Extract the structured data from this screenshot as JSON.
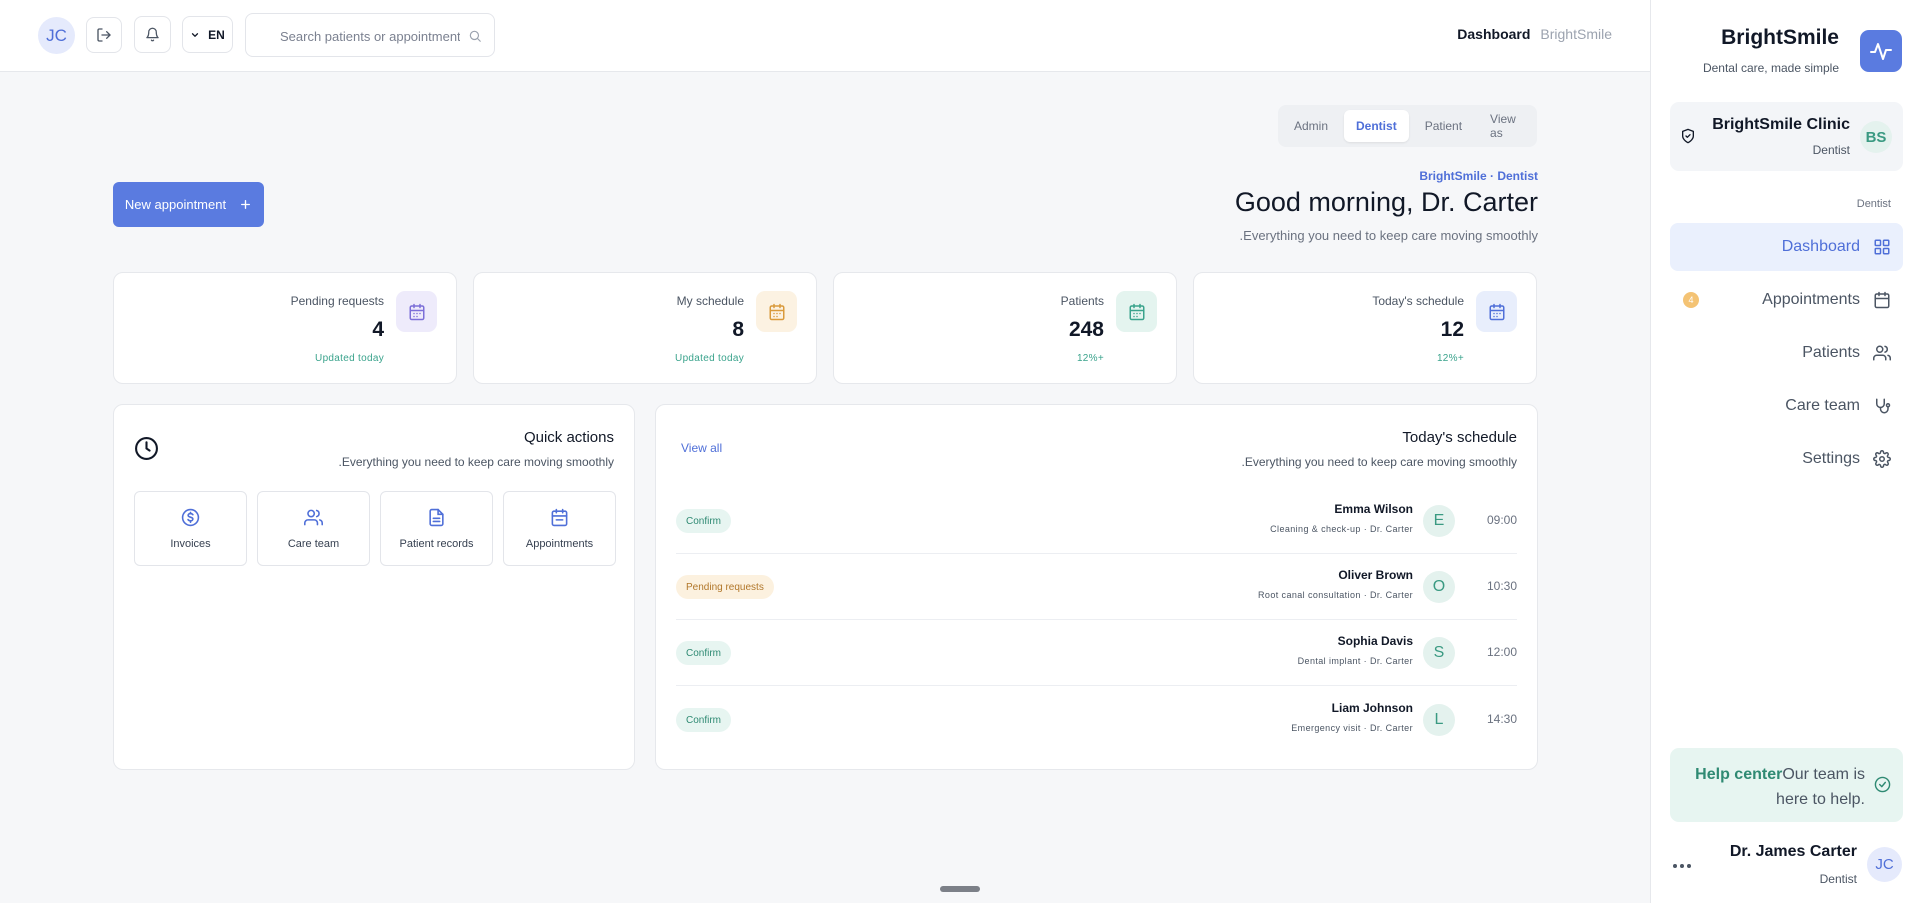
{
  "topbar": {
    "avatar_initials": "JC",
    "language": "EN",
    "search_placeholder": "Search patients or appointments",
    "breadcrumb_current": "Dashboard",
    "breadcrumb_app": "BrightSmile"
  },
  "role_tabs": [
    "Admin",
    "Dentist",
    "Patient",
    "View as"
  ],
  "role_tab_active": "Dentist",
  "hero": {
    "eyebrow": "BrightSmile · Dentist",
    "greeting": "Good morning, Dr. Carter",
    "subtitle": ".Everything you need to keep care moving smoothly",
    "new_appointment_label": "New appointment"
  },
  "stats": [
    {
      "label": "Pending requests",
      "value": "4",
      "sub": "Updated today",
      "icon": "calendar-icon",
      "color": "#7c6fd8",
      "bg": "#eeebfb"
    },
    {
      "label": "My schedule",
      "value": "8",
      "sub": "Updated today",
      "icon": "calendar-icon",
      "color": "#d99a3c",
      "bg": "#fcf2e2"
    },
    {
      "label": "Patients",
      "value": "248",
      "sub": "12%+",
      "icon": "calendar-icon",
      "color": "#3aa38c",
      "bg": "#e4f4ef"
    },
    {
      "label": "Today's schedule",
      "value": "12",
      "sub": "12%+",
      "icon": "calendar-icon",
      "color": "#4f6fd8",
      "bg": "#e8eefc"
    }
  ],
  "quick_actions": {
    "title": "Quick actions",
    "subtitle": ".Everything you need to keep care moving smoothly",
    "items": [
      {
        "label": "Invoices",
        "icon": "dollar-icon"
      },
      {
        "label": "Care team",
        "icon": "users-icon"
      },
      {
        "label": "Patient records",
        "icon": "file-icon"
      },
      {
        "label": "Appointments",
        "icon": "calendar-icon"
      }
    ]
  },
  "schedule": {
    "title": "Today's schedule",
    "subtitle": ".Everything you need to keep care moving smoothly",
    "view_all": "View all",
    "rows": [
      {
        "name": "Emma Wilson",
        "detail": "Cleaning & check-up · Dr. Carter",
        "initial": "E",
        "time": "09:00",
        "status": "Confirm",
        "status_kind": "confirm"
      },
      {
        "name": "Oliver Brown",
        "detail": "Root canal consultation · Dr. Carter",
        "initial": "O",
        "time": "10:30",
        "status": "Pending requests",
        "status_kind": "pending"
      },
      {
        "name": "Sophia Davis",
        "detail": "Dental implant · Dr. Carter",
        "initial": "S",
        "time": "12:00",
        "status": "Confirm",
        "status_kind": "confirm"
      },
      {
        "name": "Liam Johnson",
        "detail": "Emergency visit · Dr. Carter",
        "initial": "L",
        "time": "14:30",
        "status": "Confirm",
        "status_kind": "confirm"
      }
    ]
  },
  "sidebar": {
    "brand": "BrightSmile",
    "tagline": "Dental care, made simple",
    "clinic_name": "BrightSmile Clinic",
    "clinic_role": "Dentist",
    "clinic_initials": "BS",
    "section_label": "Dentist",
    "nav": [
      {
        "label": "Dashboard",
        "icon": "grid-icon",
        "active": true,
        "count": ""
      },
      {
        "label": "Appointments",
        "icon": "calendar-icon",
        "active": false,
        "count": "4"
      },
      {
        "label": "Patients",
        "icon": "users-icon",
        "active": false,
        "count": ""
      },
      {
        "label": "Care team",
        "icon": "stethoscope-icon",
        "active": false,
        "count": ""
      },
      {
        "label": "Settings",
        "icon": "gear-icon",
        "active": false,
        "count": ""
      }
    ],
    "help_title": "Help center",
    "help_text": "Our team is here to help.",
    "user_name": "Dr. James Carter",
    "user_role": "Dentist",
    "user_initials": "JC"
  },
  "colors": {
    "accent": "#5a7be0",
    "teal": "#3aa38c",
    "amber": "#d99a3c"
  }
}
